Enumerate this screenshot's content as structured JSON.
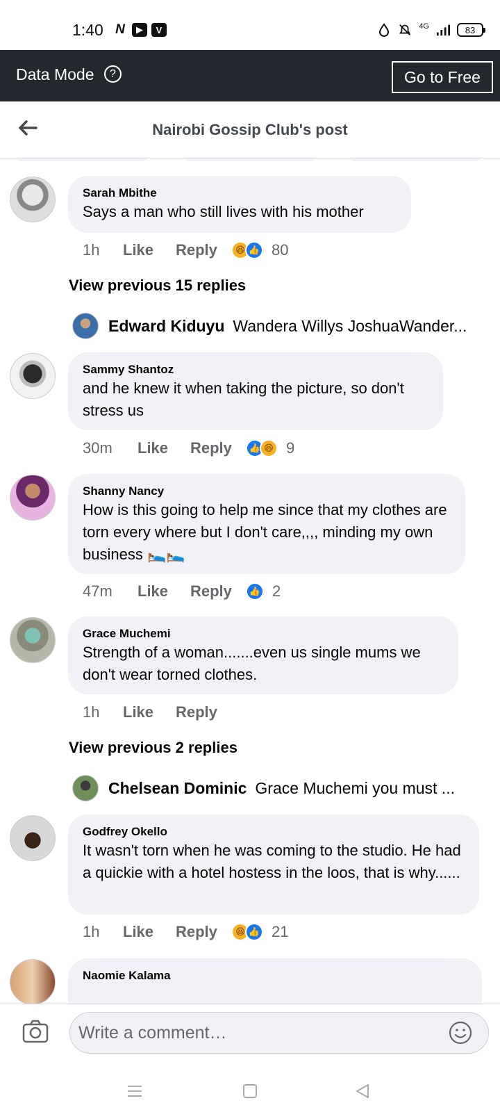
{
  "status_bar": {
    "time": "1:40",
    "network_label": "4G",
    "battery": "83"
  },
  "data_mode": {
    "title": "Data Mode",
    "help_symbol": "?",
    "go_free_label": "Go to Free"
  },
  "header": {
    "title": "Nairobi Gossip Club's post"
  },
  "comments": [
    {
      "name": "Sarah Mbithe",
      "text": "Says a man who still lives with his mother",
      "time": "1h",
      "like_label": "Like",
      "reply_label": "Reply",
      "reactions": [
        "haha",
        "like"
      ],
      "reaction_count": "80",
      "view_previous": "View previous 15 replies",
      "reply_preview": {
        "name": "Edward Kiduyu",
        "text": "Wandera Willys JoshuaWander..."
      }
    },
    {
      "name": "Sammy Shantoz",
      "text": "and he knew it when taking the picture, so don't stress us",
      "time": "30m",
      "like_label": "Like",
      "reply_label": "Reply",
      "reactions": [
        "like",
        "haha"
      ],
      "reaction_count": "9"
    },
    {
      "name": "Shanny Nancy",
      "text": "How is this going to help me since that my clothes are torn every where but I don't care,,,, minding my own business 🛌🛌",
      "time": "47m",
      "like_label": "Like",
      "reply_label": "Reply",
      "reactions": [
        "like"
      ],
      "reaction_count": "2"
    },
    {
      "name": "Grace Muchemi",
      "text": "Strength of a woman.......even us single mums we don't wear torned clothes.",
      "time": "1h",
      "like_label": "Like",
      "reply_label": "Reply",
      "reactions": [],
      "reaction_count": "",
      "view_previous": "View previous 2 replies",
      "reply_preview": {
        "name": "Chelsean Dominic",
        "text": "Grace Muchemi  you must ..."
      }
    },
    {
      "name": "Godfrey Okello",
      "text": "It wasn't torn when he was coming to the studio. He had a quickie with a hotel hostess in the loos, that is why......",
      "time": "1h",
      "like_label": "Like",
      "reply_label": "Reply",
      "reactions": [
        "haha",
        "like"
      ],
      "reaction_count": "21"
    },
    {
      "name": "Naomie Kalama"
    }
  ],
  "composer": {
    "placeholder": "Write a comment…"
  },
  "icons": {
    "back": "arrow-left-icon",
    "camera": "camera-icon",
    "emoji": "smiley-icon",
    "reaction_like_color": "#1877f2",
    "reaction_haha_color": "#f7b125"
  }
}
